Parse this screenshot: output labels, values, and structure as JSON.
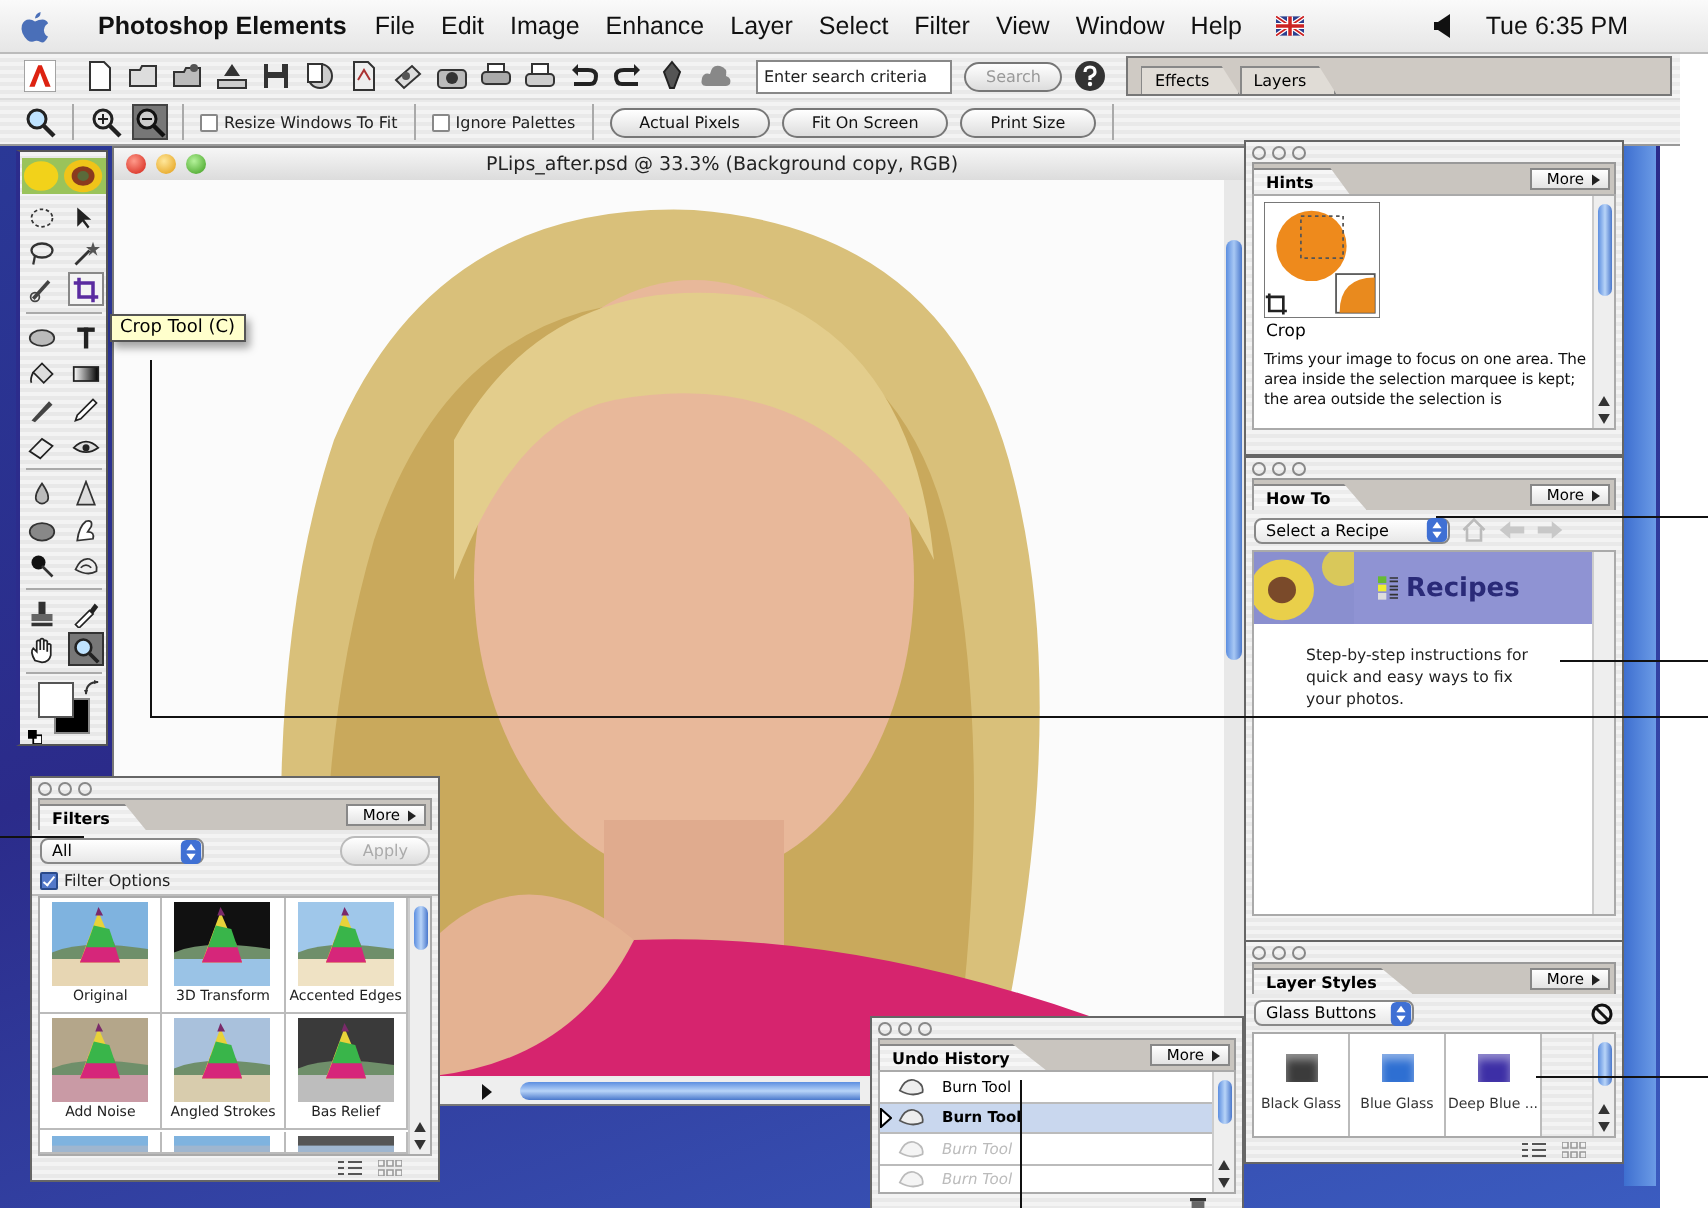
{
  "menu_bar": {
    "app_name": "Photoshop Elements",
    "menus": [
      "File",
      "Edit",
      "Image",
      "Enhance",
      "Layer",
      "Select",
      "Filter",
      "View",
      "Window",
      "Help"
    ],
    "clock": "Tue 6:35 PM"
  },
  "shortcuts_bar": {
    "search": {
      "placeholder": "Enter search criteria"
    },
    "search_button": "Search",
    "palette_well_tabs": [
      "Effects",
      "Layers"
    ]
  },
  "options_bar": {
    "checkboxes": [
      {
        "label": "Resize Windows To Fit",
        "checked": false
      },
      {
        "label": "Ignore Palettes",
        "checked": false
      }
    ],
    "buttons": [
      "Actual Pixels",
      "Fit On Screen",
      "Print Size"
    ]
  },
  "toolbox": {
    "tooltip": "Crop Tool (C)",
    "groups": [
      [
        {
          "kind": "marquee",
          "selected": false,
          "hovered": false
        },
        {
          "kind": "move",
          "selected": false,
          "hovered": false
        },
        {
          "kind": "lasso",
          "selected": false,
          "hovered": false
        },
        {
          "kind": "wand",
          "selected": false,
          "hovered": false
        },
        {
          "kind": "selbrush",
          "selected": false,
          "hovered": false
        },
        {
          "kind": "crop",
          "selected": false,
          "hovered": true
        }
      ],
      [
        {
          "kind": "shape",
          "selected": false,
          "hovered": false
        },
        {
          "kind": "type",
          "selected": false,
          "hovered": false
        },
        {
          "kind": "bucket",
          "selected": false,
          "hovered": false
        },
        {
          "kind": "gradient",
          "selected": false,
          "hovered": false
        },
        {
          "kind": "brush",
          "selected": false,
          "hovered": false
        },
        {
          "kind": "pencil",
          "selected": false,
          "hovered": false
        },
        {
          "kind": "eraser",
          "selected": false,
          "hovered": false
        },
        {
          "kind": "redeye",
          "selected": false,
          "hovered": false
        }
      ],
      [
        {
          "kind": "blur",
          "selected": false,
          "hovered": false
        },
        {
          "kind": "sharpen",
          "selected": false,
          "hovered": false
        },
        {
          "kind": "sponge",
          "selected": false,
          "hovered": false
        },
        {
          "kind": "smudge",
          "selected": false,
          "hovered": false
        },
        {
          "kind": "dodge",
          "selected": false,
          "hovered": false
        },
        {
          "kind": "burn",
          "selected": false,
          "hovered": false
        }
      ],
      [
        {
          "kind": "stamp",
          "selected": false,
          "hovered": false
        },
        {
          "kind": "eyedropper",
          "selected": false,
          "hovered": false
        },
        {
          "kind": "hand",
          "selected": false,
          "hovered": false
        },
        {
          "kind": "zoom",
          "selected": true,
          "hovered": false
        }
      ]
    ]
  },
  "image_window": {
    "title": "PLips_after.psd @ 33.3% (Background copy, RGB)"
  },
  "hints": {
    "tab": "Hints",
    "more": "More",
    "caption": "Crop",
    "text": "Trims your image to focus on one area. The area inside the selection marquee is kept; the area outside the selection is"
  },
  "how_to": {
    "tab": "How To",
    "more": "More",
    "recipe_select": "Select a Recipe",
    "banner": "Recipes",
    "text": "Step-by-step instructions for quick and easy ways to fix your photos."
  },
  "filters": {
    "tab": "Filters",
    "more": "More",
    "category": "All",
    "apply": {
      "label": "Apply",
      "disabled": true
    },
    "filter_options": {
      "label": "Filter Options",
      "checked": true
    },
    "items": [
      {
        "label": "Original"
      },
      {
        "label": "3D Transform"
      },
      {
        "label": "Accented Edges"
      },
      {
        "label": "Add Noise"
      },
      {
        "label": "Angled Strokes"
      },
      {
        "label": "Bas Relief"
      }
    ]
  },
  "layer_styles": {
    "tab": "Layer Styles",
    "more": "More",
    "library": "Glass Buttons",
    "items": [
      {
        "label": "Black Glass",
        "color": "#3b3b3b"
      },
      {
        "label": "Blue Glass",
        "color": "#2e6fd2"
      },
      {
        "label": "Deep Blue ...",
        "color": "#3d2fa6"
      }
    ]
  },
  "undo_history": {
    "tab": "Undo History",
    "more": "More",
    "items": [
      {
        "label": "Burn Tool",
        "selected": false,
        "disabled": false
      },
      {
        "label": "Burn Tool",
        "selected": true,
        "disabled": false
      },
      {
        "label": "Burn Tool",
        "selected": false,
        "disabled": true
      },
      {
        "label": "Burn Tool",
        "selected": false,
        "disabled": true
      }
    ]
  }
}
